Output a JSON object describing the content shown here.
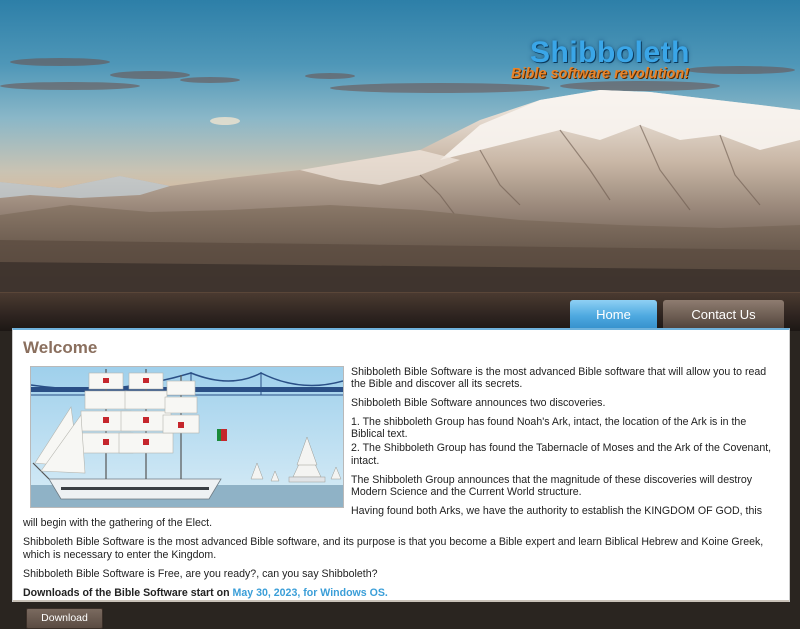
{
  "brand": {
    "title": "Shibboleth",
    "tagline": "Bible software revolution!"
  },
  "nav": {
    "tabs": [
      {
        "label": "Home",
        "active": true
      },
      {
        "label": "Contact Us",
        "active": false
      }
    ]
  },
  "main": {
    "heading": "Welcome",
    "paragraphs": [
      "Shibboleth Bible Software is the most advanced Bible software that will allow you to read the Bible and discover all its secrets.",
      "Shibboleth Bible Software announces two discoveries.",
      "1.  The shibboleth Group has found Noah's Ark, intact, the location of the Ark is in the Biblical text.",
      "2. The Shibboleth Group has found the Tabernacle of Moses and the Ark of the Covenant, intact.",
      "The Shibboleth Group announces that the magnitude of these discoveries will destroy Modern Science and the Current World structure.",
      "Having found both Arks, we have the authority to establish the KINGDOM OF GOD, this will begin with the gathering of the Elect.",
      "Shibboleth Bible Software is the most advanced Bible software, and its  purpose is that you become a Bible expert and learn Biblical Hebrew and Koine Greek, which is necessary to enter the Kingdom.",
      "Shibboleth Bible Software is Free, are you ready?, can you say Shibboleth?"
    ],
    "downloads_prefix": "Downloads of the Bible Software start on ",
    "downloads_date": "May 30, 2023, for Windows OS.",
    "download_button": "Download"
  },
  "colors": {
    "brand_title": "#3aa6e8",
    "brand_tagline": "#e8842a",
    "active_tab": "#4ea9e0",
    "inactive_tab": "#6a5a50",
    "heading": "#8a6f5e",
    "date_link": "#3a9ed8"
  }
}
